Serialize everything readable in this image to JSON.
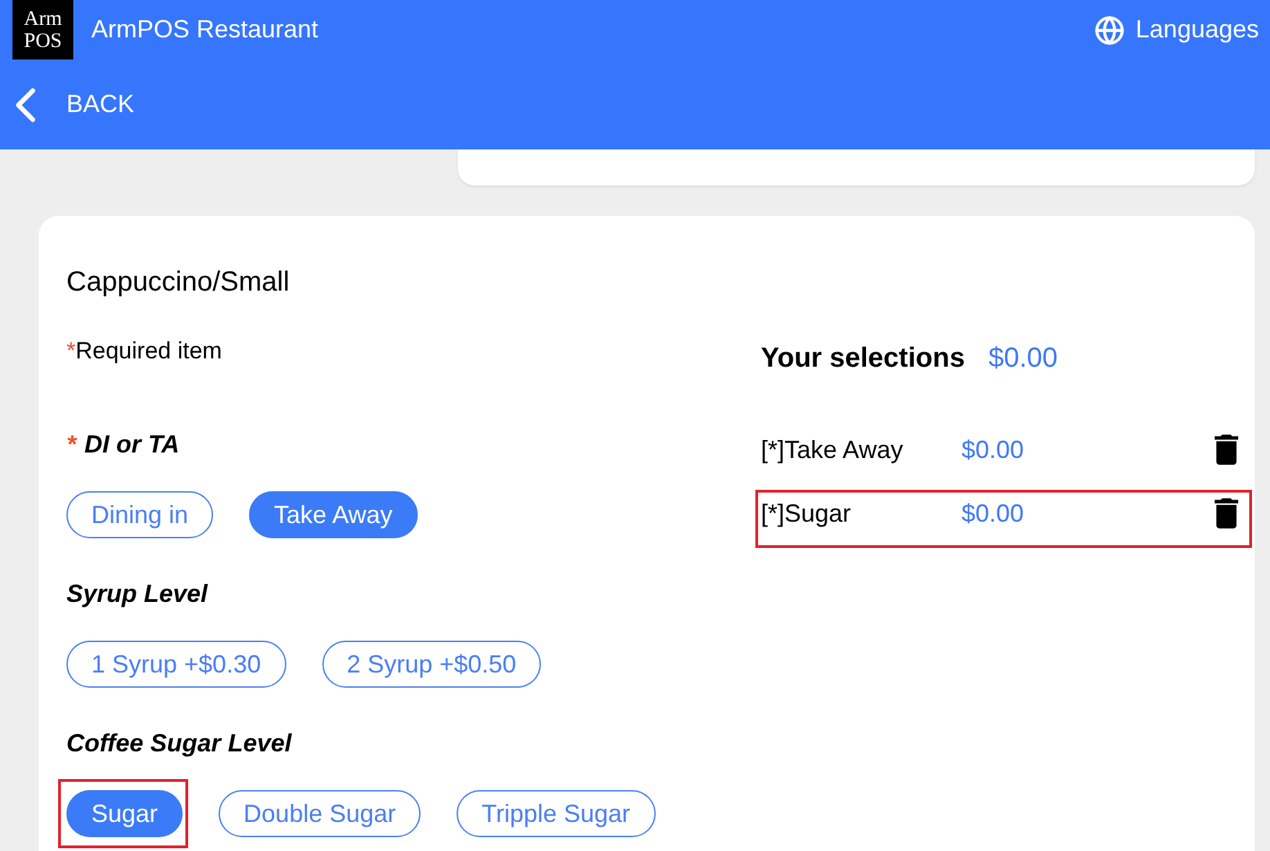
{
  "header": {
    "logo": [
      "Arm",
      "POS"
    ],
    "title": "ArmPOS Restaurant",
    "languages": "Languages",
    "back": "BACK"
  },
  "item": {
    "title": "Cappuccino/Small",
    "required_note": {
      "mark": "*",
      "text": "Required item"
    }
  },
  "option_groups": [
    {
      "required_mark": "*",
      "title": "DI or TA",
      "options": [
        {
          "label": "Dining in",
          "selected": false,
          "highlighted": false
        },
        {
          "label": "Take Away",
          "selected": true,
          "highlighted": false
        }
      ]
    },
    {
      "title": "Syrup Level",
      "options": [
        {
          "label": "1 Syrup +$0.30",
          "selected": false,
          "highlighted": false
        },
        {
          "label": "2 Syrup +$0.50",
          "selected": false,
          "highlighted": false
        }
      ]
    },
    {
      "title": "Coffee Sugar Level",
      "options": [
        {
          "label": "Sugar",
          "selected": true,
          "highlighted": true
        },
        {
          "label": "Double Sugar",
          "selected": false,
          "highlighted": false
        },
        {
          "label": "Tripple Sugar",
          "selected": false,
          "highlighted": false
        }
      ]
    }
  ],
  "selections": {
    "title": "Your selections",
    "total": "$0.00",
    "items": [
      {
        "label": "[*]Take Away",
        "price": "$0.00",
        "highlighted": false
      },
      {
        "label": "[*]Sugar",
        "price": "$0.00",
        "highlighted": true
      }
    ]
  }
}
